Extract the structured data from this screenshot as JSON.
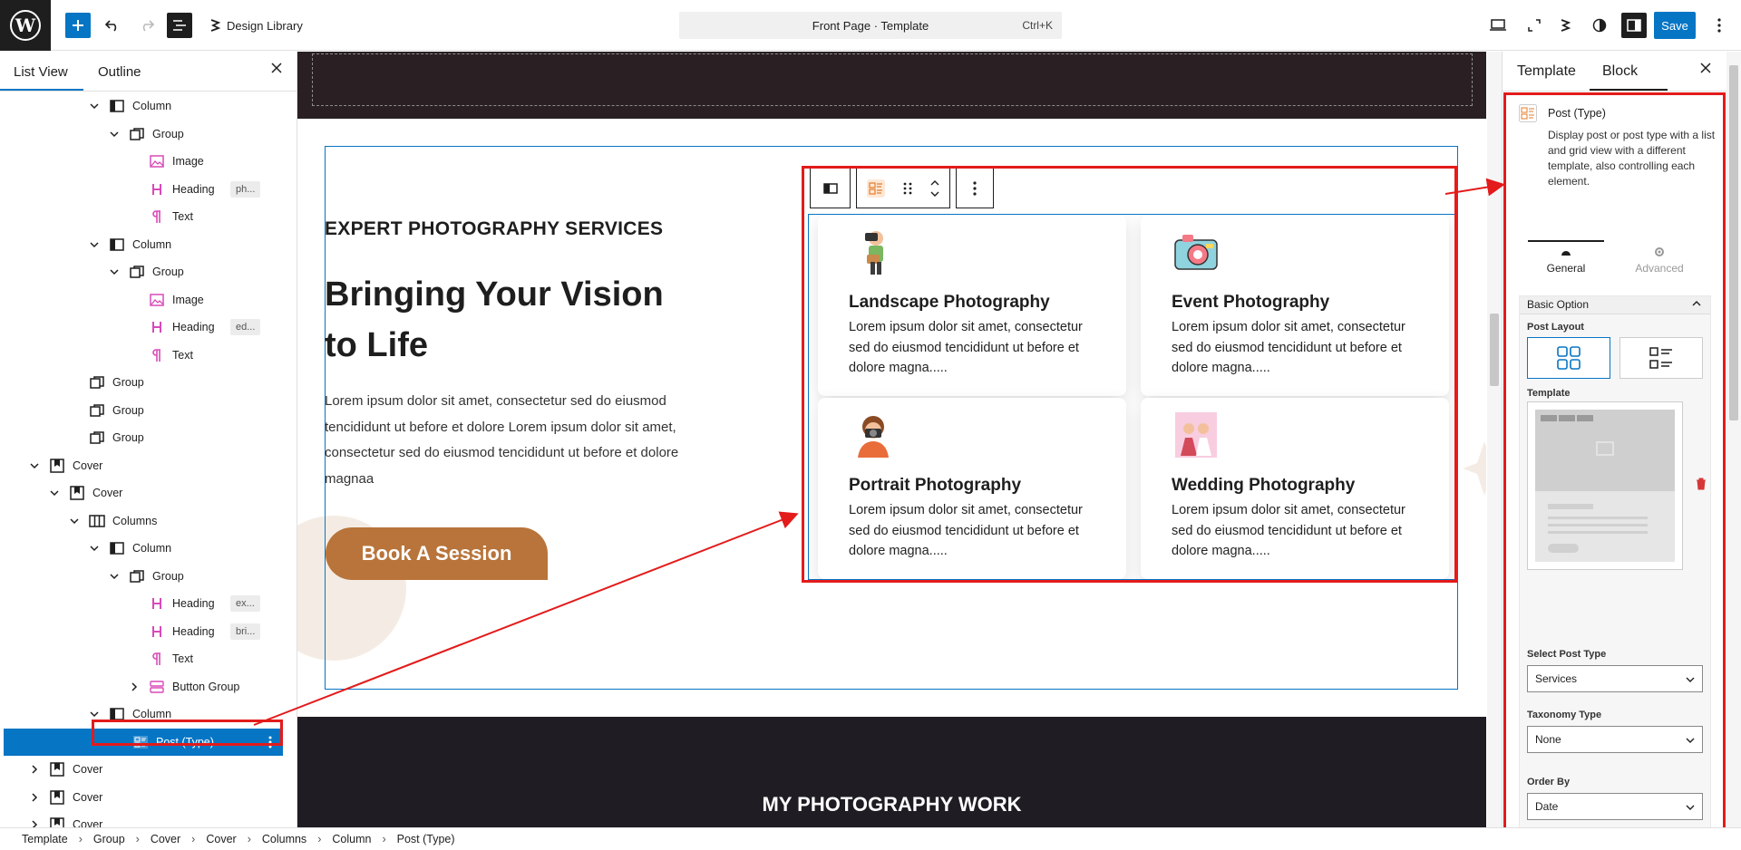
{
  "topbar": {
    "design_library": "Design Library",
    "command": "Front Page · Template",
    "shortcut": "Ctrl+K",
    "save": "Save"
  },
  "left_panel": {
    "tabs": [
      "List View",
      "Outline"
    ],
    "tree": [
      {
        "label": "Column",
        "icon": "column-icon",
        "depth": 4,
        "expanded": true
      },
      {
        "label": "Group",
        "icon": "group-icon",
        "depth": 5,
        "expanded": true
      },
      {
        "label": "Image",
        "icon": "image-icon",
        "depth": 6
      },
      {
        "label": "Heading",
        "icon": "heading-icon",
        "depth": 6,
        "badge": "ph..."
      },
      {
        "label": "Text",
        "icon": "paragraph-icon",
        "depth": 6
      },
      {
        "label": "Column",
        "icon": "column-icon",
        "depth": 4,
        "expanded": true
      },
      {
        "label": "Group",
        "icon": "group-icon",
        "depth": 5,
        "expanded": true
      },
      {
        "label": "Image",
        "icon": "image-icon",
        "depth": 6
      },
      {
        "label": "Heading",
        "icon": "heading-icon",
        "depth": 6,
        "badge": "ed..."
      },
      {
        "label": "Text",
        "icon": "paragraph-icon",
        "depth": 6
      },
      {
        "label": "Group",
        "icon": "group-icon",
        "depth": 3
      },
      {
        "label": "Group",
        "icon": "group-icon",
        "depth": 3
      },
      {
        "label": "Group",
        "icon": "group-icon",
        "depth": 3
      },
      {
        "label": "Cover",
        "icon": "cover-icon",
        "depth": 1,
        "expanded": true
      },
      {
        "label": "Cover",
        "icon": "cover-icon",
        "depth": 2,
        "expanded": true
      },
      {
        "label": "Columns",
        "icon": "columns-icon",
        "depth": 3,
        "expanded": true
      },
      {
        "label": "Column",
        "icon": "column-icon",
        "depth": 4,
        "expanded": true
      },
      {
        "label": "Group",
        "icon": "group-icon",
        "depth": 5,
        "expanded": true
      },
      {
        "label": "Heading",
        "icon": "heading-icon",
        "depth": 6,
        "badge": "ex..."
      },
      {
        "label": "Heading",
        "icon": "heading-icon",
        "depth": 6,
        "badge": "bri..."
      },
      {
        "label": "Text",
        "icon": "paragraph-icon",
        "depth": 6
      },
      {
        "label": "Button Group",
        "icon": "buttons-icon",
        "depth": 6,
        "collapsed": true
      },
      {
        "label": "Column",
        "icon": "column-icon",
        "depth": 4,
        "expanded": true
      },
      {
        "label": "Post (Type)",
        "icon": "post-type-icon",
        "depth": 5,
        "selected": true
      },
      {
        "label": "Cover",
        "icon": "cover-icon",
        "depth": 1,
        "collapsed": true
      },
      {
        "label": "Cover",
        "icon": "cover-icon",
        "depth": 1,
        "collapsed": true
      },
      {
        "label": "Cover",
        "icon": "cover-icon",
        "depth": 1,
        "collapsed": true
      }
    ]
  },
  "canvas": {
    "eyebrow": "EXPERT PHOTOGRAPHY SERVICES",
    "headline_line1": "Bringing Your Vision",
    "headline_line2": "to Life",
    "paragraph": "Lorem ipsum dolor sit amet, consectetur sed do eiusmod tencididunt ut before et dolore Lorem ipsum dolor sit amet, consectetur sed do eiusmod tencididunt ut before et dolore magnaa",
    "button": "Book A Session",
    "cards": [
      {
        "title": "Landscape Photography",
        "text": "Lorem ipsum dolor sit amet, consectetur sed do eiusmod tencididunt ut before et dolore magna.....",
        "icon": "photographer-icon"
      },
      {
        "title": "Event Photography",
        "text": "Lorem ipsum dolor sit amet, consectetur sed do eiusmod tencididunt ut before et dolore magna.....",
        "icon": "camera-icon"
      },
      {
        "title": "Portrait Photography",
        "text": "Lorem ipsum dolor sit amet, consectetur sed do eiusmod tencididunt ut before et dolore magna.....",
        "icon": "portrait-photographer-icon"
      },
      {
        "title": "Wedding Photography",
        "text": "Lorem ipsum dolor sit amet, consectetur sed do eiusmod tencididunt ut before et dolore magna.....",
        "icon": "wedding-photo-icon"
      }
    ],
    "section2_title": "MY PHOTOGRAPHY WORK"
  },
  "right_panel": {
    "tabs": [
      "Template",
      "Block"
    ],
    "block_name": "Post (Type)",
    "block_desc": "Display post or post type with a list and grid view with a different template, also controlling each element.",
    "subtabs": [
      "General",
      "Advanced"
    ],
    "basic_option": "Basic Option",
    "post_layout_label": "Post Layout",
    "template_label": "Template",
    "select_post_type_label": "Select Post Type",
    "select_post_type": "Services",
    "taxonomy_label": "Taxonomy Type",
    "taxonomy": "None",
    "order_by_label": "Order By",
    "order_by": "Date"
  },
  "breadcrumb": [
    "Template",
    "Group",
    "Cover",
    "Cover",
    "Columns",
    "Column",
    "Post (Type)"
  ],
  "colors": {
    "accent": "#0675c4",
    "button_brown": "#b8743a",
    "annotation_red": "#e31b1b",
    "dark_band": "#2a2024"
  }
}
